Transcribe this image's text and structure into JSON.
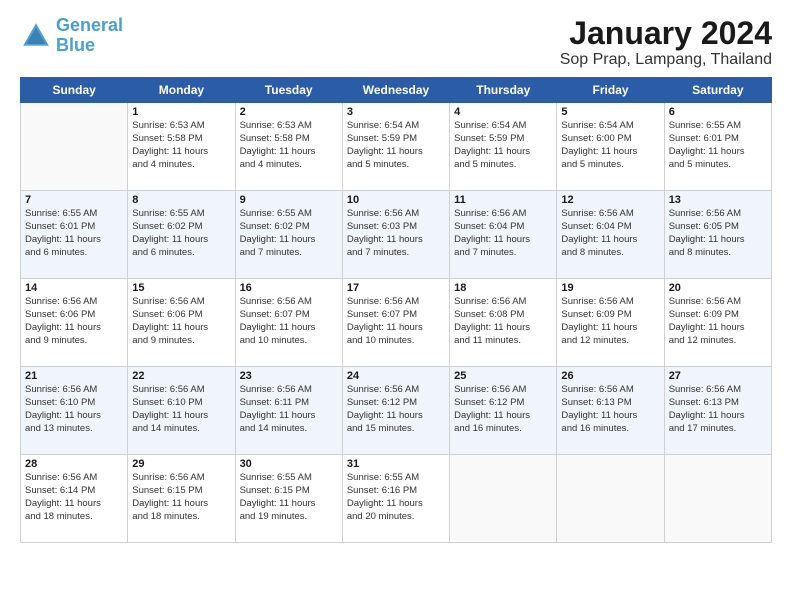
{
  "logo": {
    "line1": "General",
    "line2": "Blue"
  },
  "title": "January 2024",
  "location": "Sop Prap, Lampang, Thailand",
  "days_of_week": [
    "Sunday",
    "Monday",
    "Tuesday",
    "Wednesday",
    "Thursday",
    "Friday",
    "Saturday"
  ],
  "weeks": [
    [
      {
        "day": "",
        "info": ""
      },
      {
        "day": "1",
        "info": "Sunrise: 6:53 AM\nSunset: 5:58 PM\nDaylight: 11 hours\nand 4 minutes."
      },
      {
        "day": "2",
        "info": "Sunrise: 6:53 AM\nSunset: 5:58 PM\nDaylight: 11 hours\nand 4 minutes."
      },
      {
        "day": "3",
        "info": "Sunrise: 6:54 AM\nSunset: 5:59 PM\nDaylight: 11 hours\nand 5 minutes."
      },
      {
        "day": "4",
        "info": "Sunrise: 6:54 AM\nSunset: 5:59 PM\nDaylight: 11 hours\nand 5 minutes."
      },
      {
        "day": "5",
        "info": "Sunrise: 6:54 AM\nSunset: 6:00 PM\nDaylight: 11 hours\nand 5 minutes."
      },
      {
        "day": "6",
        "info": "Sunrise: 6:55 AM\nSunset: 6:01 PM\nDaylight: 11 hours\nand 5 minutes."
      }
    ],
    [
      {
        "day": "7",
        "info": "Sunrise: 6:55 AM\nSunset: 6:01 PM\nDaylight: 11 hours\nand 6 minutes."
      },
      {
        "day": "8",
        "info": "Sunrise: 6:55 AM\nSunset: 6:02 PM\nDaylight: 11 hours\nand 6 minutes."
      },
      {
        "day": "9",
        "info": "Sunrise: 6:55 AM\nSunset: 6:02 PM\nDaylight: 11 hours\nand 7 minutes."
      },
      {
        "day": "10",
        "info": "Sunrise: 6:56 AM\nSunset: 6:03 PM\nDaylight: 11 hours\nand 7 minutes."
      },
      {
        "day": "11",
        "info": "Sunrise: 6:56 AM\nSunset: 6:04 PM\nDaylight: 11 hours\nand 7 minutes."
      },
      {
        "day": "12",
        "info": "Sunrise: 6:56 AM\nSunset: 6:04 PM\nDaylight: 11 hours\nand 8 minutes."
      },
      {
        "day": "13",
        "info": "Sunrise: 6:56 AM\nSunset: 6:05 PM\nDaylight: 11 hours\nand 8 minutes."
      }
    ],
    [
      {
        "day": "14",
        "info": "Sunrise: 6:56 AM\nSunset: 6:06 PM\nDaylight: 11 hours\nand 9 minutes."
      },
      {
        "day": "15",
        "info": "Sunrise: 6:56 AM\nSunset: 6:06 PM\nDaylight: 11 hours\nand 9 minutes."
      },
      {
        "day": "16",
        "info": "Sunrise: 6:56 AM\nSunset: 6:07 PM\nDaylight: 11 hours\nand 10 minutes."
      },
      {
        "day": "17",
        "info": "Sunrise: 6:56 AM\nSunset: 6:07 PM\nDaylight: 11 hours\nand 10 minutes."
      },
      {
        "day": "18",
        "info": "Sunrise: 6:56 AM\nSunset: 6:08 PM\nDaylight: 11 hours\nand 11 minutes."
      },
      {
        "day": "19",
        "info": "Sunrise: 6:56 AM\nSunset: 6:09 PM\nDaylight: 11 hours\nand 12 minutes."
      },
      {
        "day": "20",
        "info": "Sunrise: 6:56 AM\nSunset: 6:09 PM\nDaylight: 11 hours\nand 12 minutes."
      }
    ],
    [
      {
        "day": "21",
        "info": "Sunrise: 6:56 AM\nSunset: 6:10 PM\nDaylight: 11 hours\nand 13 minutes."
      },
      {
        "day": "22",
        "info": "Sunrise: 6:56 AM\nSunset: 6:10 PM\nDaylight: 11 hours\nand 14 minutes."
      },
      {
        "day": "23",
        "info": "Sunrise: 6:56 AM\nSunset: 6:11 PM\nDaylight: 11 hours\nand 14 minutes."
      },
      {
        "day": "24",
        "info": "Sunrise: 6:56 AM\nSunset: 6:12 PM\nDaylight: 11 hours\nand 15 minutes."
      },
      {
        "day": "25",
        "info": "Sunrise: 6:56 AM\nSunset: 6:12 PM\nDaylight: 11 hours\nand 16 minutes."
      },
      {
        "day": "26",
        "info": "Sunrise: 6:56 AM\nSunset: 6:13 PM\nDaylight: 11 hours\nand 16 minutes."
      },
      {
        "day": "27",
        "info": "Sunrise: 6:56 AM\nSunset: 6:13 PM\nDaylight: 11 hours\nand 17 minutes."
      }
    ],
    [
      {
        "day": "28",
        "info": "Sunrise: 6:56 AM\nSunset: 6:14 PM\nDaylight: 11 hours\nand 18 minutes."
      },
      {
        "day": "29",
        "info": "Sunrise: 6:56 AM\nSunset: 6:15 PM\nDaylight: 11 hours\nand 18 minutes."
      },
      {
        "day": "30",
        "info": "Sunrise: 6:55 AM\nSunset: 6:15 PM\nDaylight: 11 hours\nand 19 minutes."
      },
      {
        "day": "31",
        "info": "Sunrise: 6:55 AM\nSunset: 6:16 PM\nDaylight: 11 hours\nand 20 minutes."
      },
      {
        "day": "",
        "info": ""
      },
      {
        "day": "",
        "info": ""
      },
      {
        "day": "",
        "info": ""
      }
    ]
  ]
}
